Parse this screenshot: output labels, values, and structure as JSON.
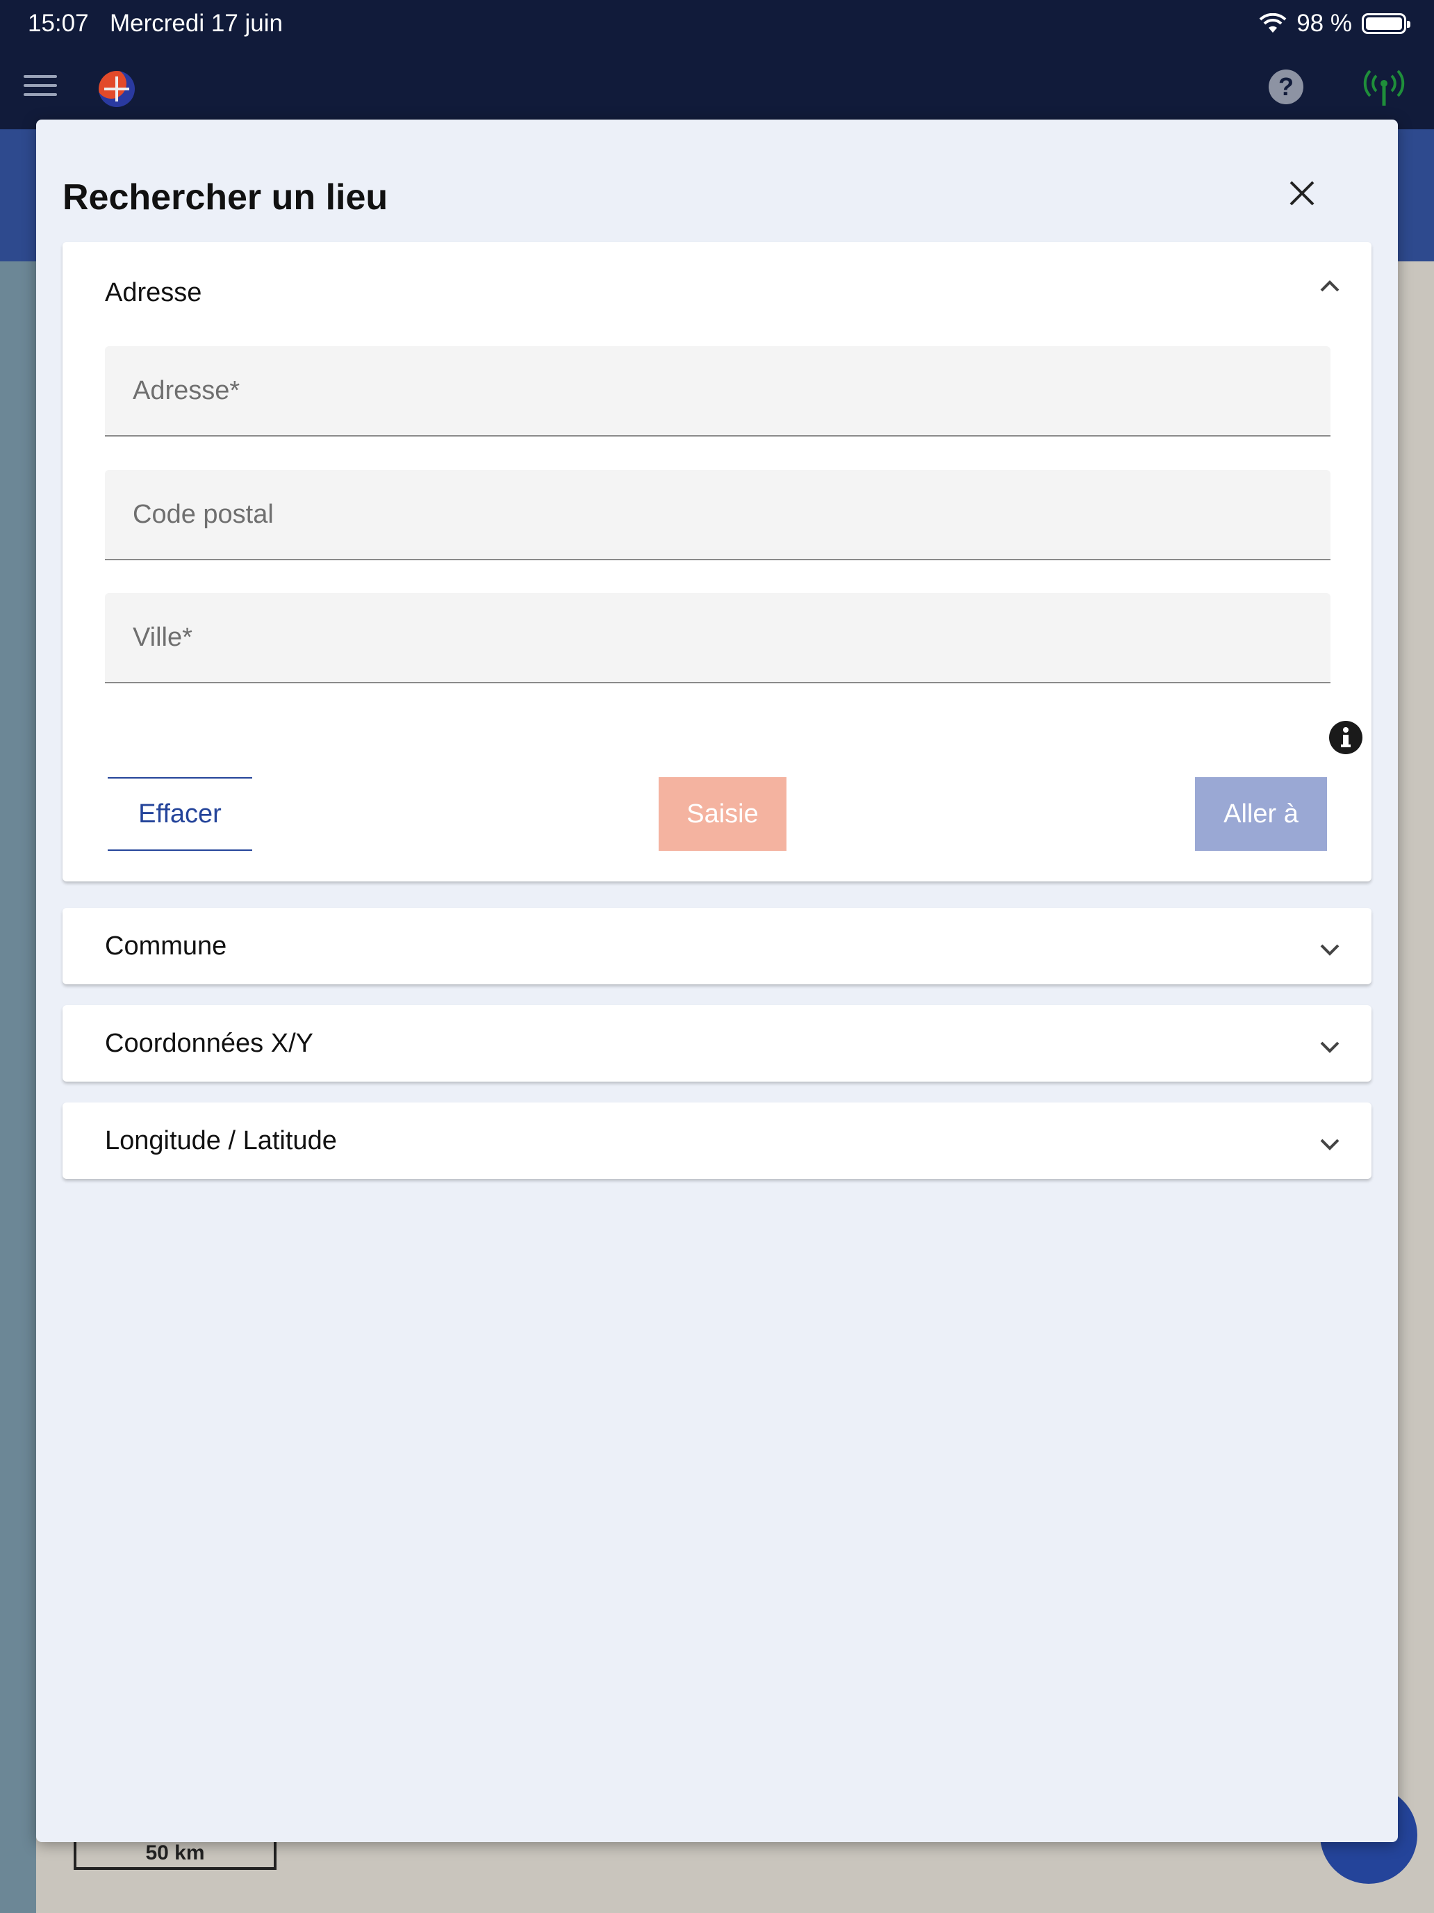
{
  "status_bar": {
    "time": "15:07",
    "date": "Mercredi 17 juin",
    "battery": "98 %"
  },
  "app_bar": {
    "help_symbol": "?"
  },
  "map": {
    "scale": "50 km"
  },
  "dialog": {
    "title": "Rechercher un lieu",
    "sections": {
      "adresse": {
        "label": "Adresse",
        "fields": {
          "adresse_placeholder": "Adresse*",
          "code_postal_placeholder": "Code postal",
          "ville_placeholder": "Ville*"
        },
        "buttons": {
          "clear": "Effacer",
          "saisie": "Saisie",
          "go": "Aller à"
        }
      },
      "commune": {
        "label": "Commune"
      },
      "coordonnees": {
        "label": "Coordonnées X/Y"
      },
      "lonlat": {
        "label": "Longitude / Latitude"
      }
    }
  },
  "colors": {
    "app_bar": "#111b3a",
    "accent": "#24449a",
    "saisie_button": "#f4b3a0",
    "go_button": "#9aa8d4",
    "signal_icon": "#1f8f3a"
  }
}
